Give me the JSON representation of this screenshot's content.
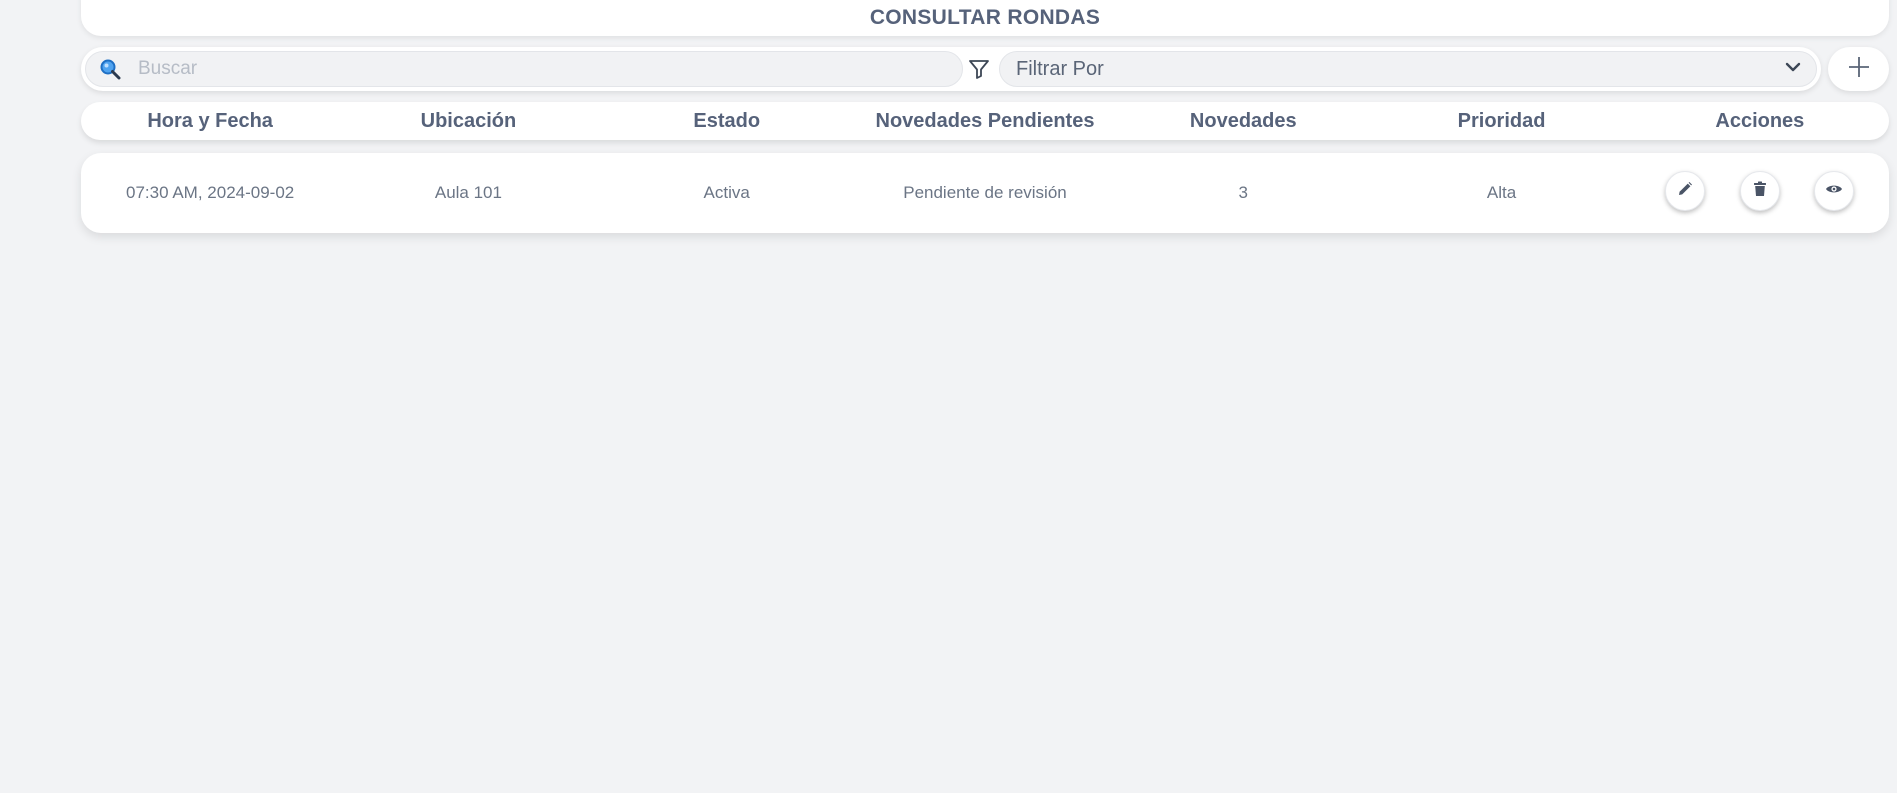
{
  "header": {
    "title": "CONSULTAR RONDAS"
  },
  "toolbar": {
    "search_placeholder": "Buscar",
    "search_value": "",
    "filter_label": "Filtrar Por",
    "icons": {
      "search": "magnifier-icon",
      "filter": "funnel-icon",
      "dropdown": "chevron-down-icon",
      "add": "plus-icon"
    }
  },
  "table": {
    "columns": [
      "Hora y Fecha",
      "Ubicación",
      "Estado",
      "Novedades Pendientes",
      "Novedades",
      "Prioridad",
      "Acciones"
    ],
    "rows": [
      {
        "hora_fecha": "07:30 AM, 2024-09-02",
        "ubicacion": "Aula 101",
        "estado": "Activa",
        "novedades_pendientes": "Pendiente de revisión",
        "novedades": "3",
        "prioridad": "Alta",
        "actions": [
          "pencil-icon",
          "trash-icon",
          "eye-icon"
        ]
      }
    ]
  },
  "colors": {
    "background": "#f2f3f5",
    "surface": "#ffffff",
    "text": "#56627a",
    "search_icon_accent": "#1e88e5"
  }
}
